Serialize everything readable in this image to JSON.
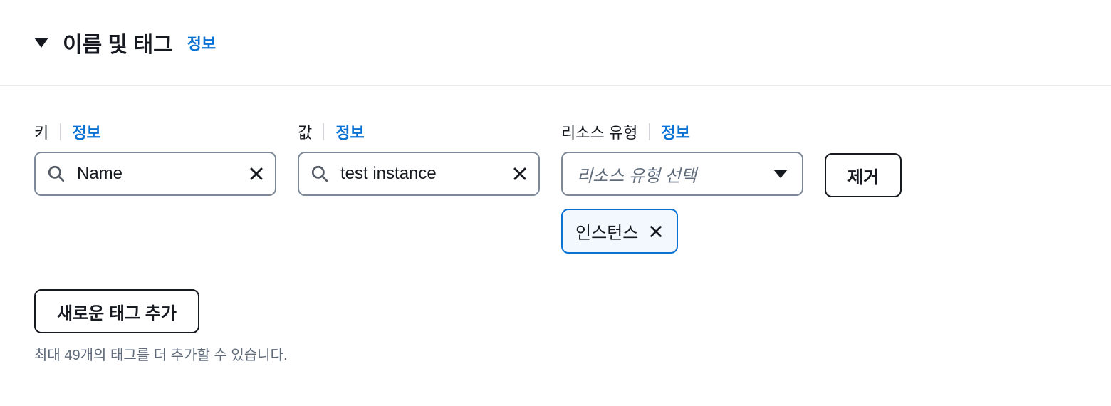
{
  "header": {
    "title": "이름 및 태그",
    "info_link": "정보"
  },
  "fields": {
    "key": {
      "label": "키",
      "info_link": "정보",
      "value": "Name"
    },
    "value": {
      "label": "값",
      "info_link": "정보",
      "value": "test instance"
    },
    "resource_type": {
      "label": "리소스 유형",
      "info_link": "정보",
      "placeholder": "리소스 유형 선택",
      "token": "인스턴스"
    }
  },
  "buttons": {
    "remove": "제거",
    "add_tag": "새로운 태그 추가"
  },
  "helper": "최대 49개의 태그를 더 추가할 수 있습니다."
}
